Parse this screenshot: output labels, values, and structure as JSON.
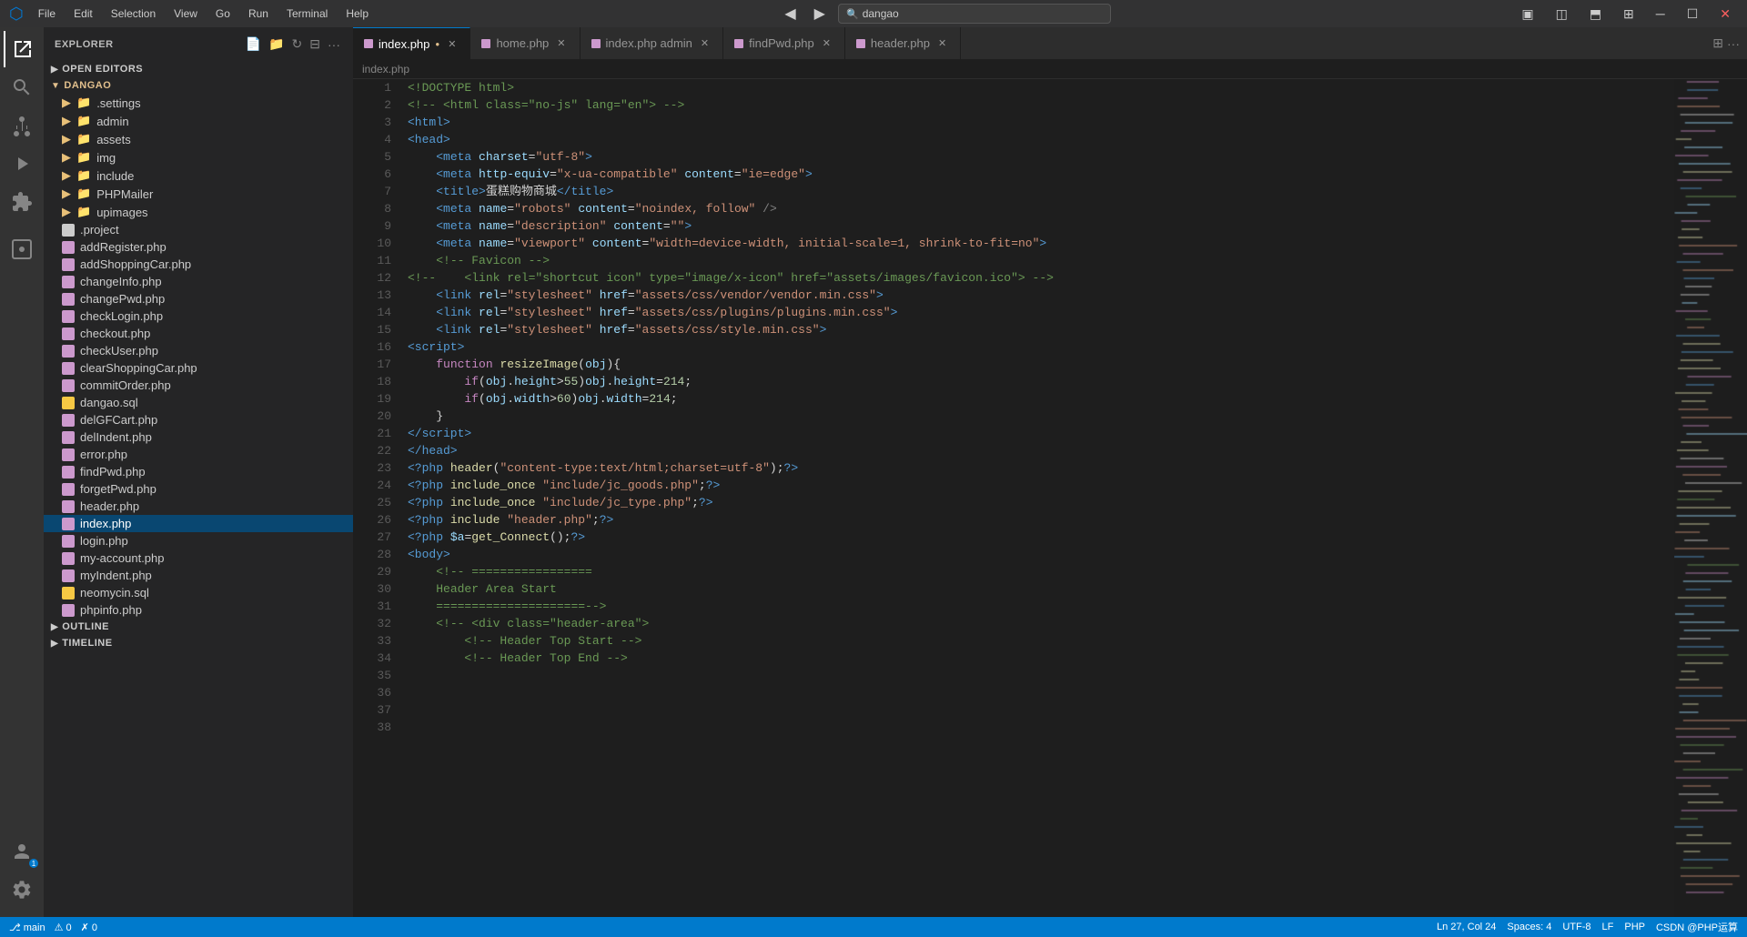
{
  "titlebar": {
    "menus": [
      "File",
      "Edit",
      "Selection",
      "View",
      "Go",
      "Run",
      "Terminal",
      "Help"
    ],
    "nav_back": "◀",
    "nav_forward": "▶",
    "search_placeholder": "dangao",
    "win_buttons": [
      "─",
      "☐",
      "✕"
    ]
  },
  "activity_bar": {
    "icons": [
      {
        "name": "explorer-icon",
        "symbol": "⎘",
        "active": true
      },
      {
        "name": "search-icon",
        "symbol": "🔍",
        "active": false
      },
      {
        "name": "source-control-icon",
        "symbol": "⑂",
        "active": false
      },
      {
        "name": "run-icon",
        "symbol": "▷",
        "active": false
      },
      {
        "name": "extensions-icon",
        "symbol": "⊞",
        "active": false
      },
      {
        "name": "remote-explorer-icon",
        "symbol": "⊡",
        "active": false
      }
    ],
    "bottom_icons": [
      {
        "name": "accounts-icon",
        "symbol": "👤"
      },
      {
        "name": "settings-icon",
        "symbol": "⚙"
      }
    ]
  },
  "sidebar": {
    "title": "EXPLORER",
    "sections": {
      "open_editors": "OPEN EDITORS",
      "project": "DANGAO"
    },
    "tree_items": [
      {
        "label": ".settings",
        "type": "folder",
        "indent": 1
      },
      {
        "label": "admin",
        "type": "folder",
        "indent": 1
      },
      {
        "label": "assets",
        "type": "folder",
        "indent": 1
      },
      {
        "label": "img",
        "type": "folder",
        "indent": 1
      },
      {
        "label": "include",
        "type": "folder",
        "indent": 1
      },
      {
        "label": "PHPMailer",
        "type": "folder",
        "indent": 1
      },
      {
        "label": "upimages",
        "type": "folder",
        "indent": 1
      },
      {
        "label": ".project",
        "type": "dot",
        "indent": 1
      },
      {
        "label": "addRegister.php",
        "type": "php",
        "indent": 1
      },
      {
        "label": "addShoppingCar.php",
        "type": "php",
        "indent": 1
      },
      {
        "label": "changeInfo.php",
        "type": "php",
        "indent": 1
      },
      {
        "label": "changePwd.php",
        "type": "php",
        "indent": 1
      },
      {
        "label": "checkLogin.php",
        "type": "php",
        "indent": 1
      },
      {
        "label": "checkout.php",
        "type": "php",
        "indent": 1
      },
      {
        "label": "checkUser.php",
        "type": "php",
        "indent": 1
      },
      {
        "label": "clearShoppingCar.php",
        "type": "php",
        "indent": 1
      },
      {
        "label": "commitOrder.php",
        "type": "php",
        "indent": 1
      },
      {
        "label": "dangao.sql",
        "type": "sql",
        "indent": 1
      },
      {
        "label": "delGFCart.php",
        "type": "php",
        "indent": 1
      },
      {
        "label": "delIndent.php",
        "type": "php",
        "indent": 1
      },
      {
        "label": "error.php",
        "type": "php",
        "indent": 1
      },
      {
        "label": "findPwd.php",
        "type": "php",
        "indent": 1
      },
      {
        "label": "forgetPwd.php",
        "type": "php",
        "indent": 1
      },
      {
        "label": "header.php",
        "type": "php",
        "indent": 1
      },
      {
        "label": "index.php",
        "type": "php",
        "indent": 1,
        "active": true
      },
      {
        "label": "login.php",
        "type": "php",
        "indent": 1
      },
      {
        "label": "my-account.php",
        "type": "php",
        "indent": 1
      },
      {
        "label": "myIndent.php",
        "type": "php",
        "indent": 1
      },
      {
        "label": "neomycin.sql",
        "type": "sql",
        "indent": 1
      },
      {
        "label": "phpinfo.php",
        "type": "php",
        "indent": 1
      }
    ],
    "sections_bottom": [
      "OUTLINE",
      "TIMELINE"
    ]
  },
  "tabs": [
    {
      "label": "index.php",
      "active": true,
      "modified": true,
      "icon": "php"
    },
    {
      "label": "home.php",
      "active": false,
      "icon": "php"
    },
    {
      "label": "index.php admin",
      "active": false,
      "icon": "php"
    },
    {
      "label": "findPwd.php",
      "active": false,
      "icon": "php"
    },
    {
      "label": "header.php",
      "active": false,
      "icon": "php"
    }
  ],
  "breadcrumb": "index.php",
  "code_lines": [
    {
      "num": 1,
      "html": "<span class='c-comment'>&lt;!DOCTYPE html&gt;</span>"
    },
    {
      "num": 2,
      "html": "<span class='c-comment'>&lt;!-- &lt;html class=\"no-js\" lang=\"en\"&gt; --&gt;</span>"
    },
    {
      "num": 3,
      "html": "<span class='c-tag'>&lt;html&gt;</span>"
    },
    {
      "num": 4,
      "html": "<span class='c-tag'>&lt;head&gt;</span>"
    },
    {
      "num": 5,
      "html": "    <span class='c-tag'>&lt;meta</span> <span class='c-attr'>charset</span><span class='c-op'>=</span><span class='c-val'>\"utf-8\"</span><span class='c-tag'>&gt;</span>"
    },
    {
      "num": 6,
      "html": "    <span class='c-tag'>&lt;meta</span> <span class='c-attr'>http-equiv</span><span class='c-op'>=</span><span class='c-val'>\"x-ua-compatible\"</span> <span class='c-attr'>content</span><span class='c-op'>=</span><span class='c-val'>\"ie=edge\"</span><span class='c-tag'>&gt;</span>"
    },
    {
      "num": 7,
      "html": "    <span class='c-tag'>&lt;title&gt;</span><span class='c-text'>蛋糕购物商城</span><span class='c-tag'>&lt;/title&gt;</span>"
    },
    {
      "num": 8,
      "html": "    <span class='c-tag'>&lt;meta</span> <span class='c-attr'>name</span><span class='c-op'>=</span><span class='c-val'>\"robots\"</span> <span class='c-attr'>content</span><span class='c-op'>=</span><span class='c-val'>\"noindex, follow\"</span> <span class='c-punct'>/&gt;</span>"
    },
    {
      "num": 9,
      "html": "    <span class='c-tag'>&lt;meta</span> <span class='c-attr'>name</span><span class='c-op'>=</span><span class='c-val'>\"description\"</span> <span class='c-attr'>content</span><span class='c-op'>=</span><span class='c-val'>\"\"</span><span class='c-tag'>&gt;</span>"
    },
    {
      "num": 10,
      "html": "    <span class='c-tag'>&lt;meta</span> <span class='c-attr'>name</span><span class='c-op'>=</span><span class='c-val'>\"viewport\"</span> <span class='c-attr'>content</span><span class='c-op'>=</span><span class='c-val'>\"width=device-width, initial-scale=1, shrink-to-fit=no\"</span><span class='c-tag'>&gt;</span>"
    },
    {
      "num": 11,
      "html": "    <span class='c-comment'>&lt;!-- Favicon --&gt;</span>"
    },
    {
      "num": 12,
      "html": "<span class='c-comment'>&lt;!--    &lt;link rel=\"shortcut icon\" type=\"image/x-icon\" href=\"assets/images/favicon.ico\"&gt; --&gt;</span>"
    },
    {
      "num": 13,
      "html": ""
    },
    {
      "num": 14,
      "html": "    <span class='c-tag'>&lt;link</span> <span class='c-attr'>rel</span><span class='c-op'>=</span><span class='c-val'>\"stylesheet\"</span> <span class='c-attr'>href</span><span class='c-op'>=</span><span class='c-val'>\"assets/css/vendor/vendor.min.css\"</span><span class='c-tag'>&gt;</span>"
    },
    {
      "num": 15,
      "html": "    <span class='c-tag'>&lt;link</span> <span class='c-attr'>rel</span><span class='c-op'>=</span><span class='c-val'>\"stylesheet\"</span> <span class='c-attr'>href</span><span class='c-op'>=</span><span class='c-val'>\"assets/css/plugins/plugins.min.css\"</span><span class='c-tag'>&gt;</span>"
    },
    {
      "num": 16,
      "html": "    <span class='c-tag'>&lt;link</span> <span class='c-attr'>rel</span><span class='c-op'>=</span><span class='c-val'>\"stylesheet\"</span> <span class='c-attr'>href</span><span class='c-op'>=</span><span class='c-val'>\"assets/css/style.min.css\"</span><span class='c-tag'>&gt;</span>"
    },
    {
      "num": 17,
      "html": "<span class='c-tag'>&lt;script&gt;</span>"
    },
    {
      "num": 18,
      "html": "    <span class='c-php-kw'>function</span> <span class='c-fn'>resizeImage</span><span class='c-op'>(</span><span class='c-var'>obj</span><span class='c-op'>){</span>"
    },
    {
      "num": 19,
      "html": "        <span class='c-php-kw'>if</span><span class='c-op'>(</span><span class='c-var'>obj</span><span class='c-op'>.</span><span class='c-attr'>height</span><span class='c-op'>&gt;</span><span class='c-num'>55</span><span class='c-op'>)</span><span class='c-var'>obj</span><span class='c-op'>.</span><span class='c-attr'>height</span><span class='c-op'>=</span><span class='c-num'>214</span><span class='c-op'>;</span>"
    },
    {
      "num": 20,
      "html": "        <span class='c-php-kw'>if</span><span class='c-op'>(</span><span class='c-var'>obj</span><span class='c-op'>.</span><span class='c-attr'>width</span><span class='c-op'>&gt;</span><span class='c-num'>60</span><span class='c-op'>)</span><span class='c-var'>obj</span><span class='c-op'>.</span><span class='c-attr'>width</span><span class='c-op'>=</span><span class='c-num'>214</span><span class='c-op'>;</span>"
    },
    {
      "num": 21,
      "html": "    <span class='c-op'>}</span>"
    },
    {
      "num": 22,
      "html": "<span class='c-tag'>&lt;/script&gt;</span>"
    },
    {
      "num": 23,
      "html": "<span class='c-tag'>&lt;/head&gt;</span>"
    },
    {
      "num": 24,
      "html": "<span class='c-php'>&lt;?php</span> <span class='c-fn'>header</span><span class='c-op'>(</span><span class='c-str'>\"content-type:text/html;charset=utf-8\"</span><span class='c-op'>);</span><span class='c-php'>?&gt;</span>"
    },
    {
      "num": 25,
      "html": "<span class='c-php'>&lt;?php</span> <span class='c-fn'>include_once</span> <span class='c-str'>\"include/jc_goods.php\"</span><span class='c-op'>;</span><span class='c-php'>?&gt;</span>"
    },
    {
      "num": 26,
      "html": "<span class='c-php'>&lt;?php</span> <span class='c-fn'>include_once</span> <span class='c-str'>\"include/jc_type.php\"</span><span class='c-op'>;</span><span class='c-php'>?&gt;</span>"
    },
    {
      "num": 27,
      "html": "<span class='c-php'>&lt;?php</span> <span class='c-fn'>include</span> <span class='c-str'>\"header.php\"</span><span class='c-op'>;</span><span class='c-php'>?&gt;</span>"
    },
    {
      "num": 28,
      "html": "<span class='c-php'>&lt;?php</span> <span class='c-var'>$a</span><span class='c-op'>=</span><span class='c-fn'>get_Connect</span><span class='c-op'>();</span><span class='c-php'>?&gt;</span>"
    },
    {
      "num": 29,
      "html": "<span class='c-tag'>&lt;body&gt;</span>"
    },
    {
      "num": 30,
      "html": ""
    },
    {
      "num": 31,
      "html": "    <span class='c-comment'>&lt;!-- =================</span>"
    },
    {
      "num": 32,
      "html": "    <span class='c-comment'>Header Area Start</span>"
    },
    {
      "num": 33,
      "html": "    <span class='c-comment'>=====================--&gt;</span>"
    },
    {
      "num": 34,
      "html": "    <span class='c-comment'>&lt;!-- &lt;div class=\"header-area\"&gt;</span>"
    },
    {
      "num": 35,
      "html": "        <span class='c-comment'>&lt;!-- Header Top Start --&gt;</span>"
    },
    {
      "num": 36,
      "html": ""
    },
    {
      "num": 37,
      "html": ""
    },
    {
      "num": 38,
      "html": "        <span class='c-comment'>&lt;!-- Header Top End --&gt;</span>"
    }
  ],
  "status_bar": {
    "left": [
      "⎇ main",
      "⚠ 0",
      "✗ 0"
    ],
    "right": [
      "Ln 27, Col 24",
      "Spaces: 4",
      "UTF-8",
      "LF",
      "PHP",
      "CSDN @PHP运算"
    ]
  }
}
